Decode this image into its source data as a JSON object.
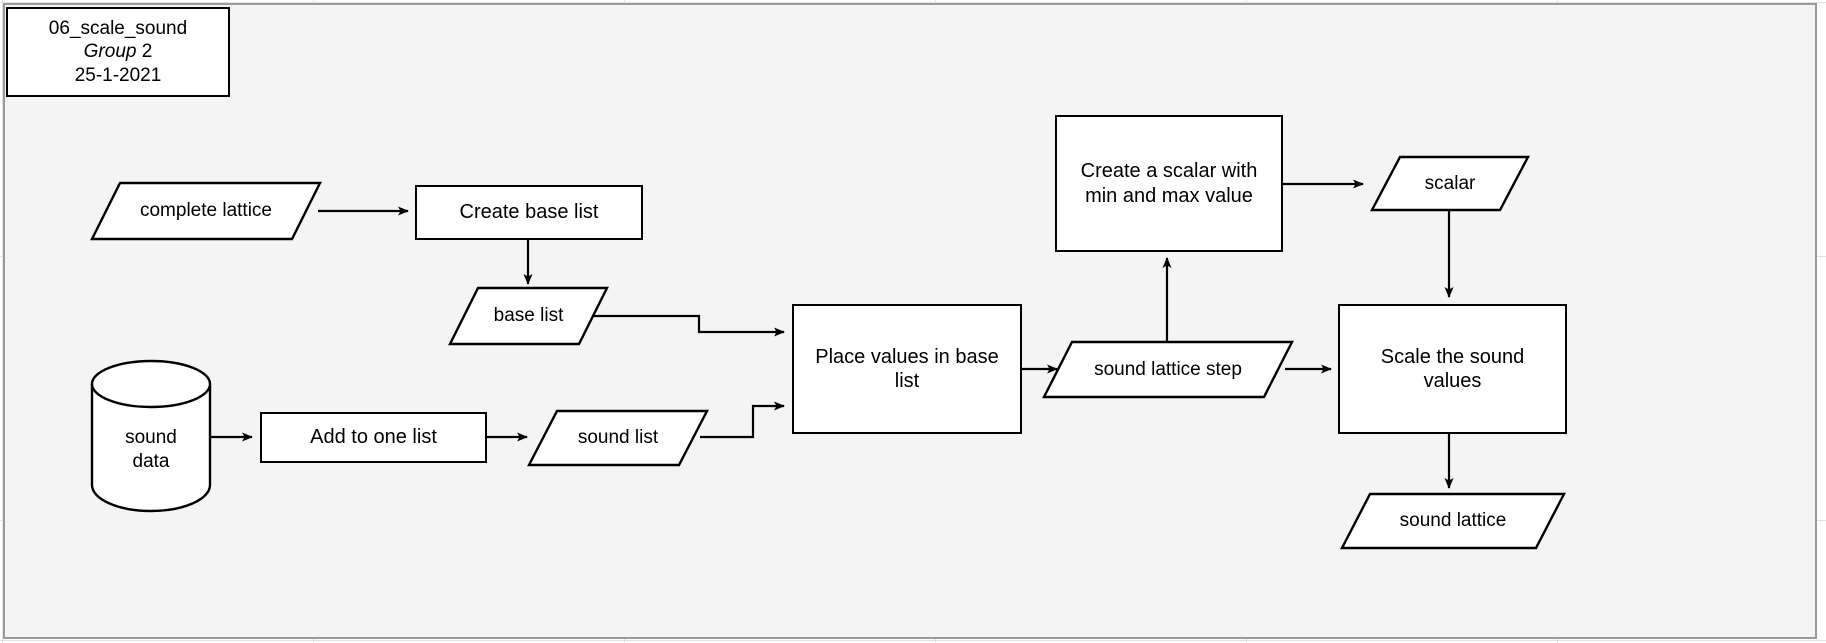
{
  "canvas": {
    "background_color": "#f4f4f4",
    "border_color": "#9a9a9a",
    "page_background_color": "#ffffff"
  },
  "title_block": {
    "name": "06_scale_sound",
    "group": "Group 2",
    "group_italic_word": "Group",
    "group_number": "2",
    "date": "25-1-2021"
  },
  "nodes": {
    "complete_lattice": {
      "label": "complete lattice",
      "shape": "parallelogram"
    },
    "create_base_list": {
      "label": "Create base list",
      "shape": "process"
    },
    "base_list": {
      "label": "base list",
      "shape": "parallelogram"
    },
    "sound_data": {
      "label_line1": "sound",
      "label_line2": "data",
      "shape": "cylinder"
    },
    "add_to_one_list": {
      "label": "Add to one list",
      "shape": "process"
    },
    "sound_list": {
      "label": "sound list",
      "shape": "parallelogram"
    },
    "place_values": {
      "label_line1": "Place values in base",
      "label_line2": "list",
      "shape": "process"
    },
    "sound_lattice_step": {
      "label": "sound lattice step",
      "shape": "parallelogram"
    },
    "create_scalar": {
      "label_line1": "Create a scalar with",
      "label_line2": "min and max value",
      "shape": "process"
    },
    "scalar": {
      "label": "scalar",
      "shape": "parallelogram"
    },
    "scale_sound_values": {
      "label_line1": "Scale the sound",
      "label_line2": "values",
      "shape": "process"
    },
    "sound_lattice": {
      "label": "sound lattice",
      "shape": "parallelogram"
    }
  },
  "edges": [
    {
      "from": "complete_lattice",
      "to": "create_base_list"
    },
    {
      "from": "create_base_list",
      "to": "base_list"
    },
    {
      "from": "base_list",
      "to": "place_values"
    },
    {
      "from": "sound_data",
      "to": "add_to_one_list"
    },
    {
      "from": "add_to_one_list",
      "to": "sound_list"
    },
    {
      "from": "sound_list",
      "to": "place_values"
    },
    {
      "from": "place_values",
      "to": "sound_lattice_step"
    },
    {
      "from": "sound_lattice_step",
      "to": "create_scalar"
    },
    {
      "from": "sound_lattice_step",
      "to": "scale_sound_values"
    },
    {
      "from": "create_scalar",
      "to": "scalar"
    },
    {
      "from": "scalar",
      "to": "scale_sound_values"
    },
    {
      "from": "scale_sound_values",
      "to": "sound_lattice"
    }
  ]
}
